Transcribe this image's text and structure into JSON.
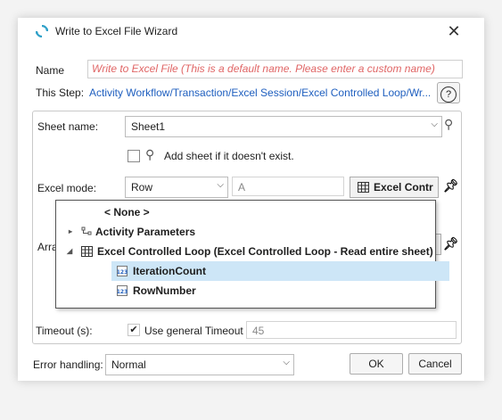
{
  "window": {
    "title": "Write to Excel File Wizard",
    "close_glyph": "✕"
  },
  "name": {
    "label": "Name",
    "placeholder": "Write to Excel File  (This is a default name. Please enter a custom name)"
  },
  "step": {
    "label": "This Step:",
    "path": "Activity Workflow/Transaction/Excel Session/Excel Controlled Loop/Wr...",
    "help_glyph": "?"
  },
  "sheet": {
    "label": "Sheet name:",
    "value": "Sheet1",
    "add_sheet_label": "Add sheet if it doesn't exist."
  },
  "excel_mode": {
    "label": "Excel mode:",
    "value": "Row",
    "column_value": "A",
    "button_label": "Excel Contr"
  },
  "array": {
    "label_partial": "Arra"
  },
  "popup": {
    "items": [
      {
        "label": "< None >",
        "level": 0
      },
      {
        "label": "Activity Parameters",
        "level": 0,
        "expander": "▸"
      },
      {
        "label": "Excel Controlled Loop (Excel Controlled Loop - Read entire sheet)",
        "level": 0,
        "expander": "◢"
      },
      {
        "label": "IterationCount",
        "level": 1,
        "selected": true
      },
      {
        "label": "RowNumber",
        "level": 1
      }
    ]
  },
  "timeout": {
    "label": "Timeout (s):",
    "use_general_label": "Use general Timeout",
    "value": "45",
    "checked_glyph": "✔"
  },
  "error_handling": {
    "label": "Error handling:",
    "value": "Normal"
  },
  "buttons": {
    "ok": "OK",
    "cancel": "Cancel"
  },
  "colors": {
    "link": "#1f5fbf",
    "placeholder": "#e06666",
    "selection": "#cde6f7"
  }
}
